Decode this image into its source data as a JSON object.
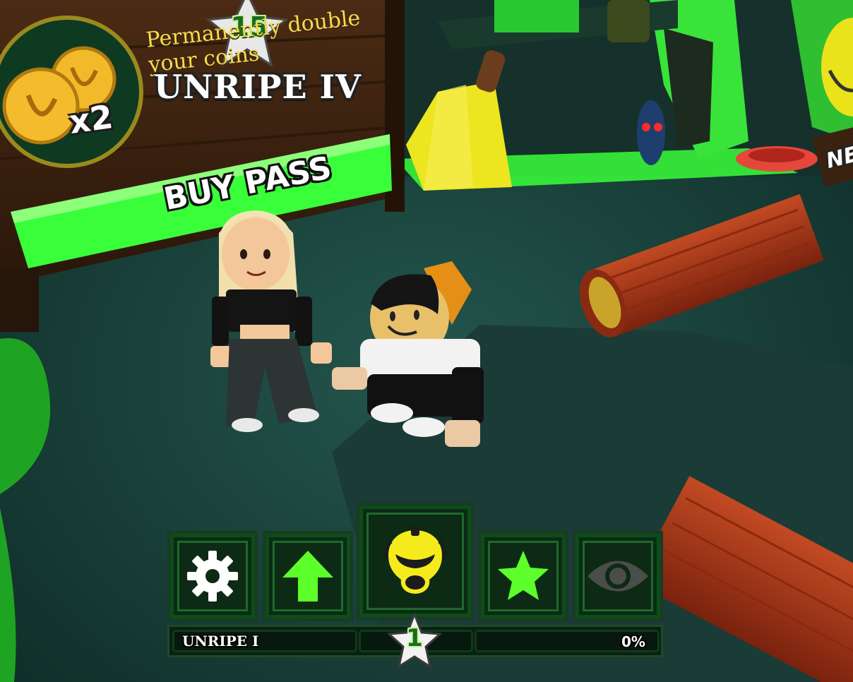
{
  "pass_sign": {
    "badge_number": "15",
    "description": "Permanently double your coins",
    "title": "UNRIPE IV",
    "multiplier": "x2",
    "buy_label": "BUY PASS"
  },
  "new_sign": {
    "label": "NE"
  },
  "toolbar": {
    "items": [
      {
        "name": "settings",
        "icon": "gear-icon"
      },
      {
        "name": "upgrade",
        "icon": "arrow-up-icon"
      },
      {
        "name": "skins",
        "icon": "banana-mask-icon"
      },
      {
        "name": "rewards",
        "icon": "star-icon"
      },
      {
        "name": "spectate",
        "icon": "eye-icon"
      }
    ]
  },
  "level": {
    "name": "UNRIPE I",
    "number": "1",
    "percent": "0%",
    "progress": 0
  },
  "colors": {
    "accent_green": "#33d12e",
    "neon_green": "#5cff2a",
    "banana_yellow": "#f5e21c",
    "panel_dark": "#0c2a14"
  }
}
